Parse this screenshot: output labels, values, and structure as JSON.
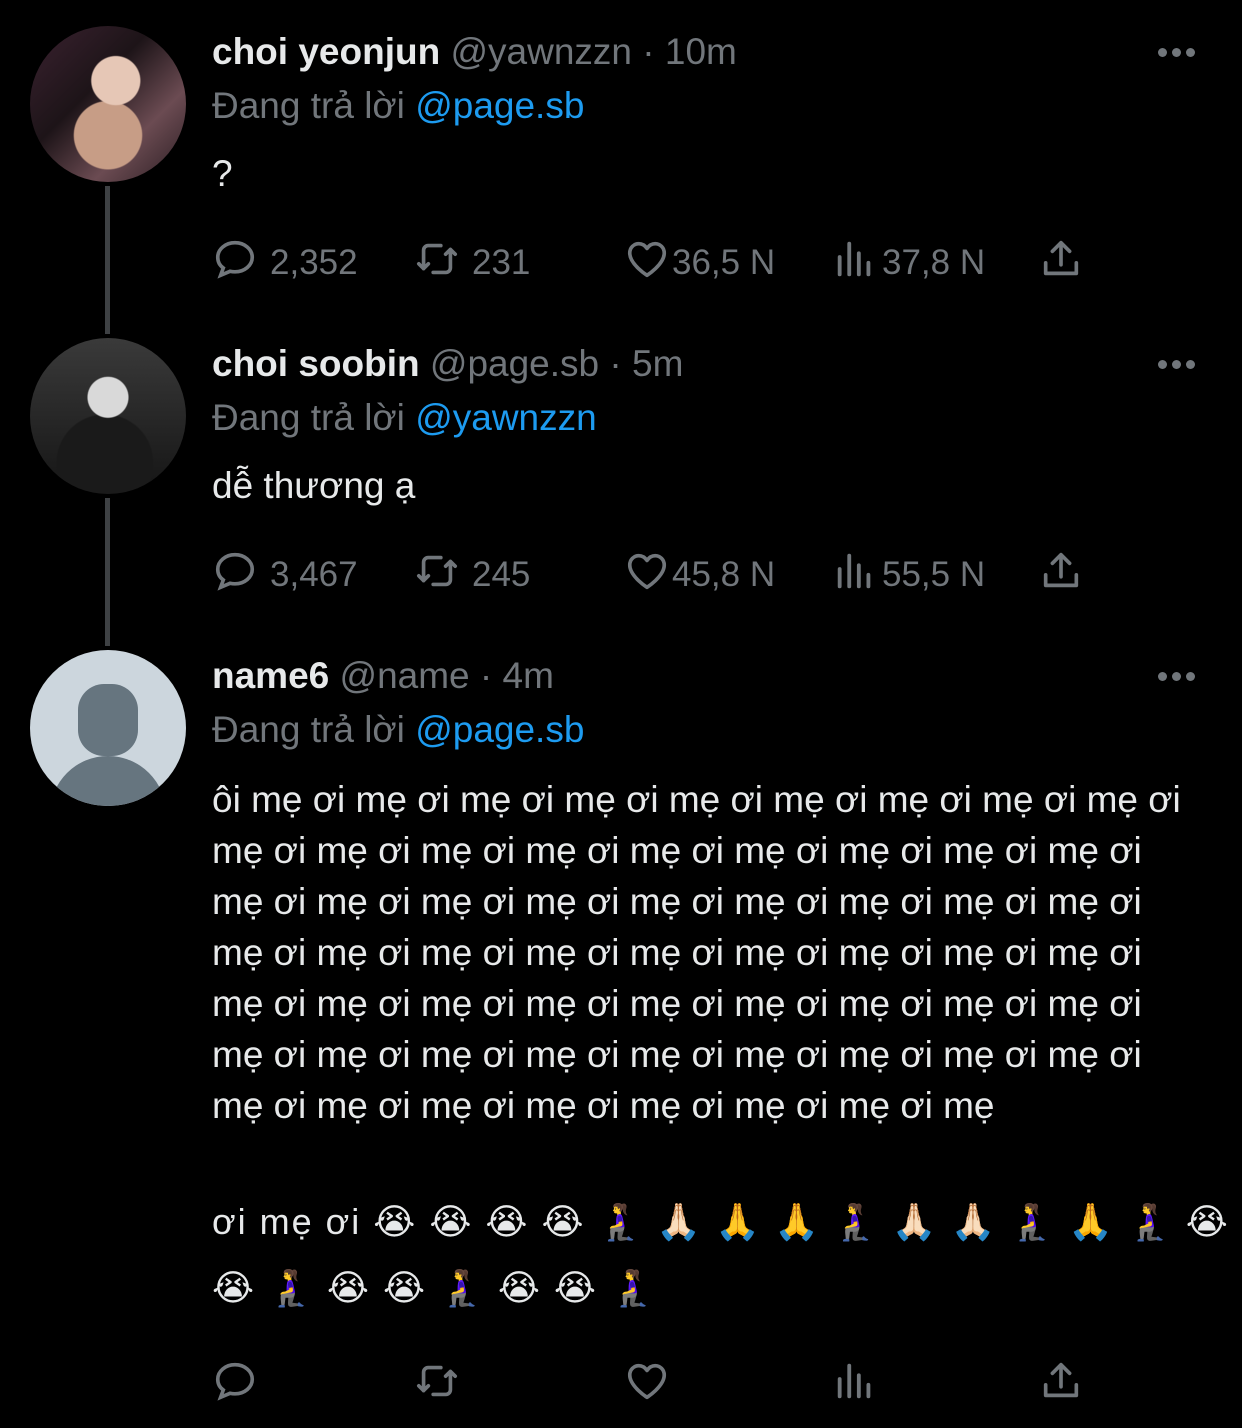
{
  "tweets": [
    {
      "name": "choi yeonjun",
      "handle": "@yawnzzn",
      "time": "· 10m",
      "reply_prefix": "Đang trả lời",
      "reply_handle": "@page.sb",
      "text": "?",
      "stats": {
        "replies": "2,352",
        "retweets": "231",
        "likes": "36,5 N",
        "views": "37,8 N"
      }
    },
    {
      "name": "choi soobin",
      "handle": "@page.sb",
      "time": "· 5m",
      "reply_prefix": "Đang trả lời",
      "reply_handle": "@yawnzzn",
      "text": "dễ thương ạ",
      "stats": {
        "replies": "3,467",
        "retweets": "245",
        "likes": "45,8 N",
        "views": "55,5 N"
      }
    },
    {
      "name": "name6",
      "handle": "@name",
      "time": "· 4m",
      "reply_prefix": "Đang trả lời",
      "reply_handle": "@page.sb",
      "text": "ôi mẹ ơi mẹ ơi mẹ ơi mẹ ơi mẹ ơi mẹ ơi mẹ ơi mẹ ơi mẹ ơi mẹ ơi mẹ ơi mẹ ơi mẹ ơi mẹ ơi mẹ ơi mẹ ơi mẹ ơi mẹ ơi mẹ ơi mẹ ơi mẹ ơi mẹ ơi mẹ ơi mẹ ơi mẹ ơi mẹ ơi mẹ ơi mẹ ơi mẹ ơi mẹ ơi mẹ ơi mẹ ơi mẹ ơi mẹ ơi mẹ ơi mẹ ơi mẹ ơi mẹ ơi mẹ ơi mẹ ơi mẹ ơi mẹ ơi mẹ ơi mẹ ơi mẹ ơi mẹ ơi mẹ ơi mẹ ơi mẹ ơi mẹ ơi mẹ ơi mẹ ơi mẹ ơi mẹ ơi mẹ ơi mẹ ơi mẹ ơi mẹ ơi mẹ ơi mẹ ơi mẹ ơi mẹ",
      "text_tail": "ơi mẹ ơi",
      "emoji_line1": "😭 😭 😭 😭 🧎‍♀️ 🙏🏻 🙏 🙏 🧎‍♀️ 🙏🏻 🙏🏻 🧎‍♀️ 🙏 🧎‍♀️ 😭",
      "emoji_line2": "😭 🧎‍♀️ 😭 😭 🧎‍♀️ 😭 😭 🧎‍♀️"
    }
  ],
  "colors": {
    "accent": "#1d9bf0",
    "muted": "#71767b",
    "text": "#e7e9ea",
    "background": "#000000"
  },
  "icons": [
    "reply-icon",
    "retweet-icon",
    "like-icon",
    "views-icon",
    "share-icon",
    "more-icon"
  ]
}
